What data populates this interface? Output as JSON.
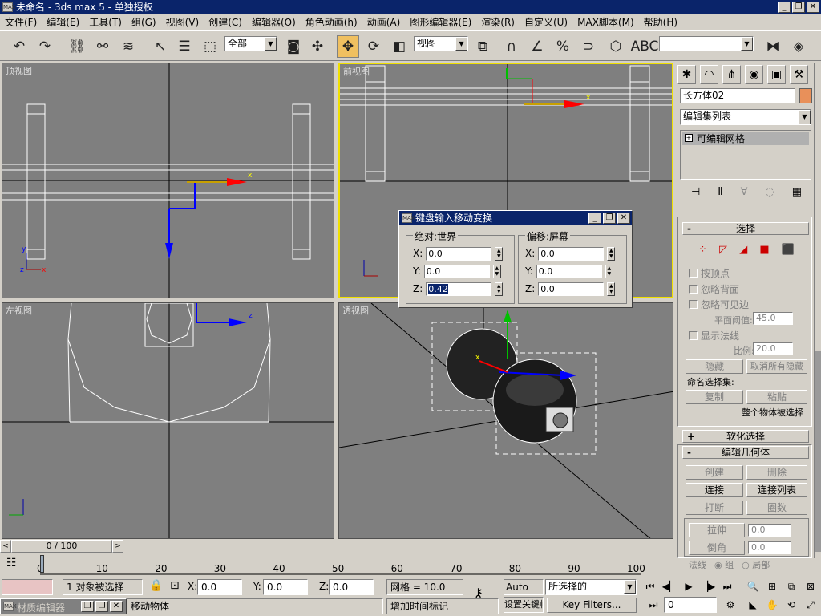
{
  "window": {
    "title": "未命名 - 3ds max 5 - 单独授权",
    "app_icon": "3ds-max-icon",
    "min": "_",
    "max": "❐",
    "close": "✕"
  },
  "menu": [
    "文件(F)",
    "编辑(E)",
    "工具(T)",
    "组(G)",
    "视图(V)",
    "创建(C)",
    "编辑器(O)",
    "角色动画(h)",
    "动画(A)",
    "图形编辑器(E)",
    "渲染(R)",
    "自定义(U)",
    "MAX脚本(M)",
    "帮助(H)"
  ],
  "toolbar": {
    "selection_filter": "全部",
    "ref_coord": "视图",
    "named_selection": "",
    "snap_angle_label": "3",
    "snap_percent_label": "%"
  },
  "viewports": {
    "top": {
      "label": "顶视图"
    },
    "front": {
      "label": "前视图"
    },
    "left": {
      "label": "左视图"
    },
    "persp": {
      "label": "透视图"
    }
  },
  "axis_labels": {
    "x": "x",
    "y": "y",
    "z": "z"
  },
  "command_panel": {
    "object_name": "长方体02",
    "object_color": "#e8905a",
    "modifier_list": "编辑集列表",
    "stack_item": "可编辑网格",
    "selection_rollout": "选择",
    "by_vertex": "按顶点",
    "ignore_back": "忽略背面",
    "ignore_visible": "忽略可见边",
    "plane_thresh_label": "平面阈值:",
    "plane_thresh": "45.0",
    "show_normals": "显示法线",
    "scale_label": "比例:",
    "scale": "20.0",
    "hide": "隐藏",
    "unhide_all": "取消所有隐藏",
    "named_sel": "命名选择集:",
    "copy": "复制",
    "paste": "粘贴",
    "whole_obj": "整个物体被选择",
    "soft_sel": "软化选择",
    "edit_geom": "编辑几何体",
    "create": "创建",
    "delete": "删除",
    "attach": "连接",
    "attach_list": "连接列表",
    "detach": "打断",
    "tessellate": "圈数",
    "extrude": "拉伸",
    "extrude_val": "0.0",
    "chamfer": "倒角",
    "chamfer_val": "0.0",
    "normal_label": "法线",
    "group_radio": "组",
    "local_radio": "局部"
  },
  "dialog": {
    "title": "键盘输入移动变换",
    "absolute_group": "绝对:世界",
    "offset_group": "偏移:屏幕",
    "abs": {
      "x": "0.0",
      "y": "0.0",
      "z": "0.42"
    },
    "off": {
      "x": "0.0",
      "y": "0.0",
      "z": "0.0"
    },
    "x_label": "X:",
    "y_label": "Y:",
    "z_label": "Z:",
    "footer_fragment": "设 ..."
  },
  "timeline": {
    "frame": "0 / 100",
    "ticks": [
      "0",
      "10",
      "20",
      "30",
      "40",
      "50",
      "60",
      "70",
      "80",
      "90",
      "100"
    ],
    "progress": 0.0
  },
  "status": {
    "selected": "1 对象被选择",
    "prompt": "移动物体",
    "x_label": "X:",
    "x": "0.0",
    "y_label": "Y:",
    "y": "0.0",
    "z_label": "Z:",
    "z": "0.0",
    "grid": "网格 = 10.0",
    "add_time_tag": "增加时间标记",
    "auto_key": "Auto Key",
    "set_key": "设置关键帧",
    "key_mode": "所选择的",
    "key_filters": "Key Filters...",
    "frame_field": "0",
    "material_editor": "材质编辑器"
  }
}
